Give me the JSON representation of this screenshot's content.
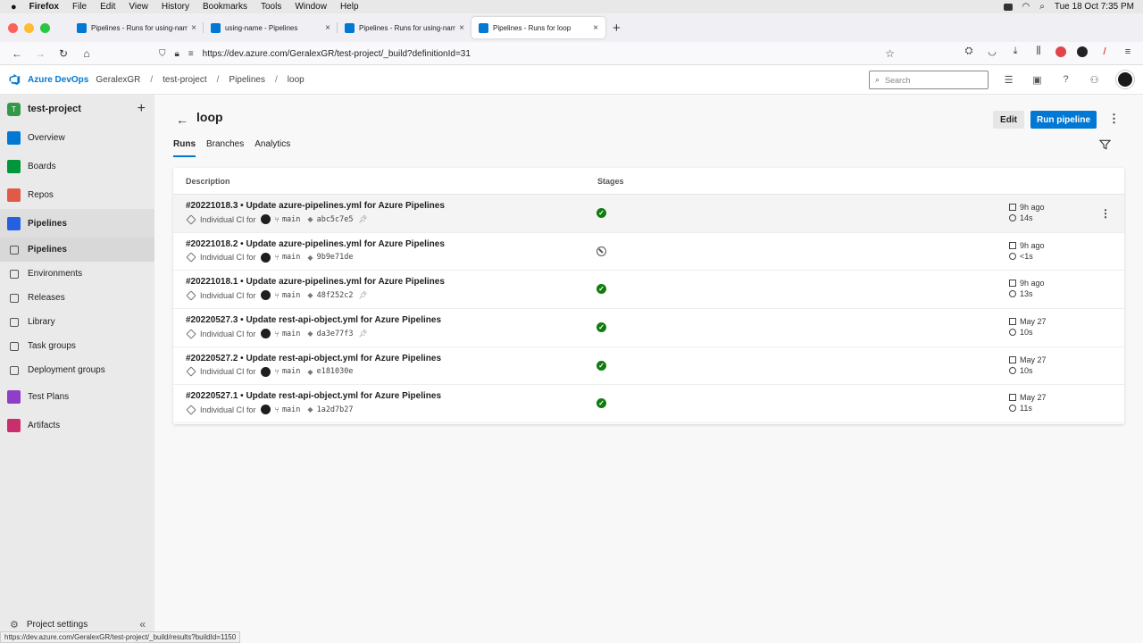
{
  "macos": {
    "app": "Firefox",
    "menus": [
      "File",
      "Edit",
      "View",
      "History",
      "Bookmarks",
      "Tools",
      "Window",
      "Help"
    ],
    "clock": "Tue 18 Oct  7:35 PM"
  },
  "browser": {
    "tabs": [
      {
        "title": "Pipelines - Runs for using-name"
      },
      {
        "title": "using-name - Pipelines"
      },
      {
        "title": "Pipelines - Runs for using-name"
      },
      {
        "title": "Pipelines - Runs for loop"
      }
    ],
    "url": "https://dev.azure.com/GeralexGR/test-project/_build?definitionId=31",
    "status_url": "https://dev.azure.com/GeralexGR/test-project/_build/results?buildId=1150"
  },
  "header": {
    "brand": "Azure DevOps",
    "org": "GeralexGR",
    "breadcrumbs": [
      "test-project",
      "Pipelines",
      "loop"
    ],
    "search_placeholder": "Search"
  },
  "sidebar": {
    "project_initial": "T",
    "project_name": "test-project",
    "items": [
      {
        "label": "Overview",
        "color": "#0078d4"
      },
      {
        "label": "Boards",
        "color": "#009639"
      },
      {
        "label": "Repos",
        "color": "#e05a47"
      },
      {
        "label": "Pipelines",
        "color": "#2560e0"
      }
    ],
    "sub_items": [
      {
        "label": "Pipelines"
      },
      {
        "label": "Environments"
      },
      {
        "label": "Releases"
      },
      {
        "label": "Library"
      },
      {
        "label": "Task groups"
      },
      {
        "label": "Deployment groups"
      }
    ],
    "more_items": [
      {
        "label": "Test Plans",
        "color": "#8f3ec7"
      },
      {
        "label": "Artifacts",
        "color": "#cb2e6d"
      }
    ],
    "settings": "Project settings"
  },
  "main": {
    "title": "loop",
    "edit_label": "Edit",
    "run_label": "Run pipeline",
    "tabs": [
      "Runs",
      "Branches",
      "Analytics"
    ],
    "col_description": "Description",
    "col_stages": "Stages",
    "runs": [
      {
        "title": "#20221018.3 • Update azure-pipelines.yml for Azure Pipelines",
        "trigger": "Individual CI for",
        "branch": "main",
        "commit": "abc5c7e5",
        "stage": "success",
        "when": "9h ago",
        "duration": "14s",
        "pinned": true
      },
      {
        "title": "#20221018.2 • Update azure-pipelines.yml for Azure Pipelines",
        "trigger": "Individual CI for",
        "branch": "main",
        "commit": "9b9e71de",
        "stage": "skipped",
        "when": "9h ago",
        "duration": "<1s",
        "pinned": false
      },
      {
        "title": "#20221018.1 • Update azure-pipelines.yml for Azure Pipelines",
        "trigger": "Individual CI for",
        "branch": "main",
        "commit": "48f252c2",
        "stage": "success",
        "when": "9h ago",
        "duration": "13s",
        "pinned": true
      },
      {
        "title": "#20220527.3 • Update rest-api-object.yml for Azure Pipelines",
        "trigger": "Individual CI for",
        "branch": "main",
        "commit": "da3e77f3",
        "stage": "success",
        "when": "May 27",
        "duration": "10s",
        "pinned": true
      },
      {
        "title": "#20220527.2 • Update rest-api-object.yml for Azure Pipelines",
        "trigger": "Individual CI for",
        "branch": "main",
        "commit": "e181030e",
        "stage": "success",
        "when": "May 27",
        "duration": "10s",
        "pinned": false
      },
      {
        "title": "#20220527.1 • Update rest-api-object.yml for Azure Pipelines",
        "trigger": "Individual CI for",
        "branch": "main",
        "commit": "1a2d7b27",
        "stage": "success",
        "when": "May 27",
        "duration": "11s",
        "pinned": false
      }
    ]
  }
}
